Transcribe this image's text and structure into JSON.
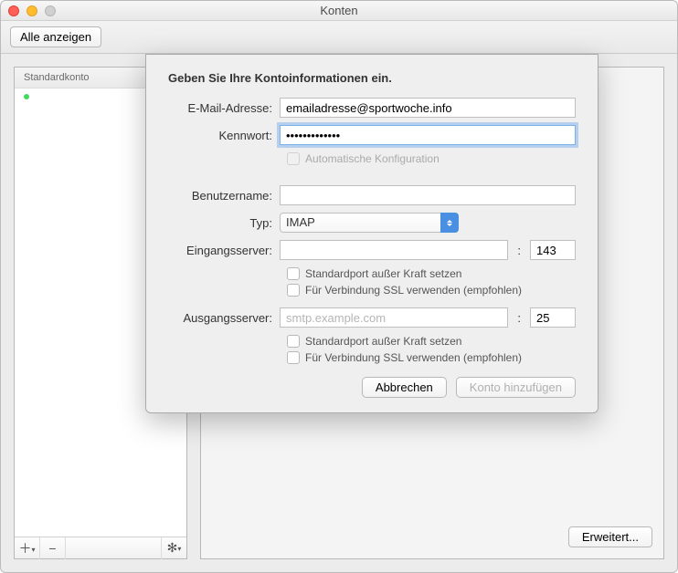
{
  "window": {
    "title": "Konten"
  },
  "toolbar": {
    "show_all": "Alle anzeigen"
  },
  "sidebar": {
    "account_label": "Standardkonto",
    "footer_add": "+",
    "footer_remove": "−",
    "footer_gear_dropdown": "✻"
  },
  "main": {
    "advanced_button": "Erweitert..."
  },
  "dialog": {
    "heading": "Geben Sie Ihre Kontoinformationen ein.",
    "labels": {
      "email": "E-Mail-Adresse:",
      "password": "Kennwort:",
      "username": "Benutzername:",
      "type": "Typ:",
      "incoming": "Eingangsserver:",
      "outgoing": "Ausgangsserver:"
    },
    "values": {
      "email": "emailadresse@sportwoche.info",
      "password": "•••••••••••••",
      "auto_config": "Automatische Konfiguration",
      "username": "",
      "type": "IMAP",
      "incoming_server": "",
      "incoming_port": "143",
      "outgoing_server_placeholder": "smtp.example.com",
      "outgoing_server": "",
      "outgoing_port": "25",
      "override_port": "Standardport außer Kraft setzen",
      "use_ssl": "Für Verbindung SSL verwenden (empfohlen)"
    },
    "buttons": {
      "cancel": "Abbrechen",
      "add": "Konto hinzufügen"
    }
  }
}
